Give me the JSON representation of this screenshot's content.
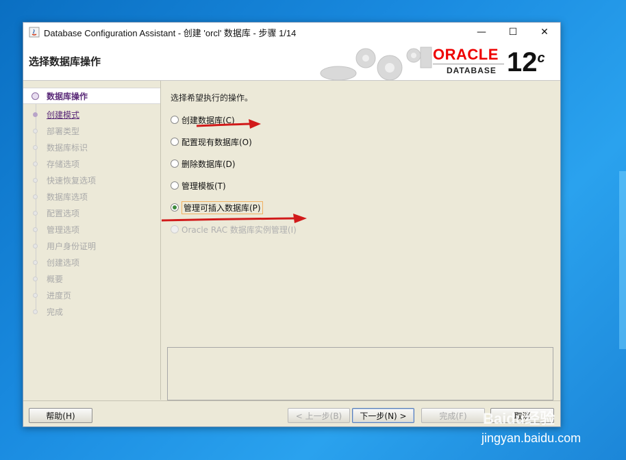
{
  "window": {
    "title": "Database Configuration Assistant - 创建 'orcl' 数据库 - 步骤 1/14",
    "controls": {
      "minimize": "—",
      "maximize": "☐",
      "close": "✕"
    }
  },
  "banner": {
    "title": "选择数据库操作",
    "logo_brand": "ORACLE",
    "logo_product": "DATABASE",
    "version_number": "12",
    "version_suffix": "c"
  },
  "nav": {
    "items": [
      {
        "label": "数据库操作",
        "state": "current"
      },
      {
        "label": "创建模式",
        "state": "link"
      },
      {
        "label": "部署类型",
        "state": "disabled"
      },
      {
        "label": "数据库标识",
        "state": "disabled"
      },
      {
        "label": "存储选项",
        "state": "disabled"
      },
      {
        "label": "快速恢复选项",
        "state": "disabled"
      },
      {
        "label": "数据库选项",
        "state": "disabled"
      },
      {
        "label": "配置选项",
        "state": "disabled"
      },
      {
        "label": "管理选项",
        "state": "disabled"
      },
      {
        "label": "用户身份证明",
        "state": "disabled"
      },
      {
        "label": "创建选项",
        "state": "disabled"
      },
      {
        "label": "概要",
        "state": "disabled"
      },
      {
        "label": "进度页",
        "state": "disabled"
      },
      {
        "label": "完成",
        "state": "disabled"
      }
    ]
  },
  "content": {
    "prompt": "选择希望执行的操作。",
    "options": [
      {
        "label": "创建数据库(C)",
        "checked": false,
        "enabled": true
      },
      {
        "label": "配置现有数据库(O)",
        "checked": false,
        "enabled": true
      },
      {
        "label": "删除数据库(D)",
        "checked": false,
        "enabled": true
      },
      {
        "label": "管理模板(T)",
        "checked": false,
        "enabled": true
      },
      {
        "label": "管理可插入数据库(P)",
        "checked": true,
        "enabled": true
      },
      {
        "label": "Oracle RAC 数据库实例管理(I)",
        "checked": false,
        "enabled": false
      }
    ]
  },
  "footer": {
    "help": "帮助(H)",
    "back": "< 上一步(B)",
    "next": "下一步(N) >",
    "finish": "完成(F)",
    "cancel": "取消"
  },
  "watermark": {
    "brand": "Baidu经验",
    "url": "jingyan.baidu.com"
  },
  "colors": {
    "accent_purple": "#5a2a78",
    "oracle_red": "#e00000",
    "arrow_red": "#d11a1a"
  }
}
